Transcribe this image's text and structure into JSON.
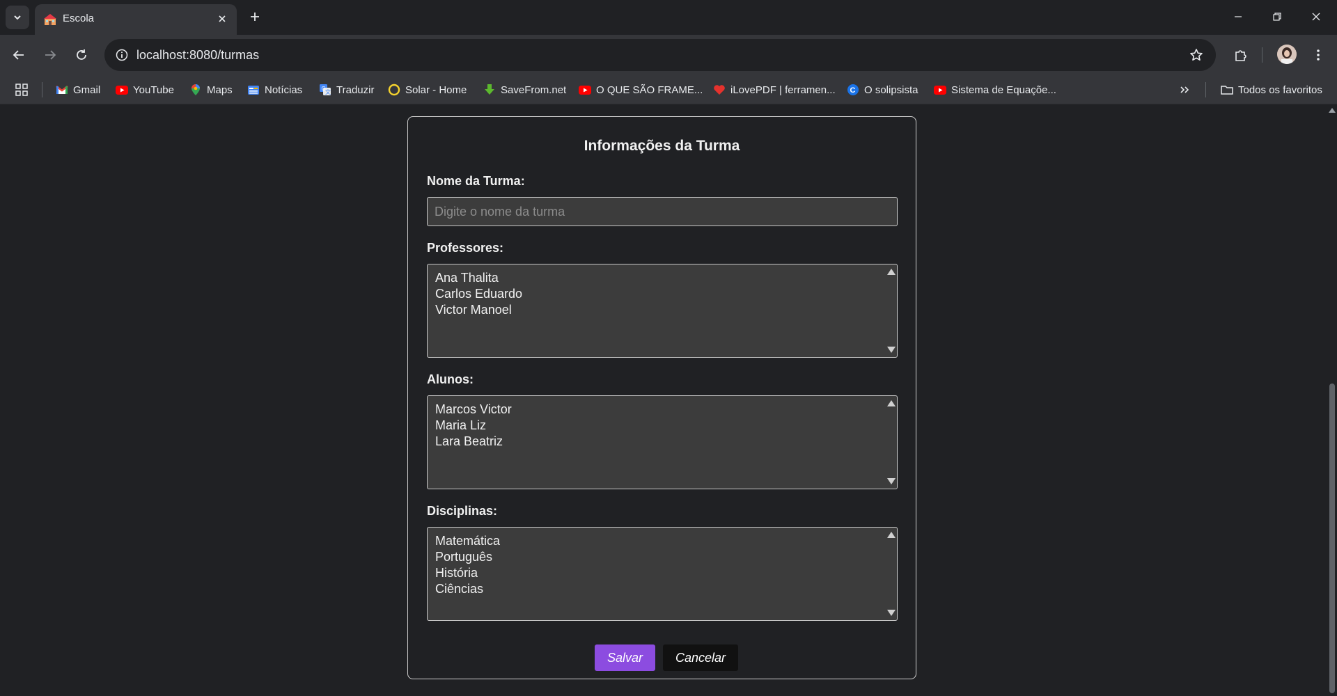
{
  "browser": {
    "tab": {
      "title": "Escola"
    },
    "address": {
      "url": "localhost:8080/turmas"
    },
    "bookmarks": [
      {
        "label": "Gmail",
        "icon": "gmail-icon"
      },
      {
        "label": "YouTube",
        "icon": "youtube-icon"
      },
      {
        "label": "Maps",
        "icon": "maps-icon"
      },
      {
        "label": "Notícias",
        "icon": "news-icon"
      },
      {
        "label": "Traduzir",
        "icon": "translate-icon"
      },
      {
        "label": "Solar - Home",
        "icon": "solar-icon"
      },
      {
        "label": "SaveFrom.net",
        "icon": "savefrom-icon"
      },
      {
        "label": "O QUE SÃO FRAME...",
        "icon": "youtube-icon"
      },
      {
        "label": "iLovePDF | ferramen...",
        "icon": "ilovepdf-icon"
      },
      {
        "label": "O solipsista",
        "icon": "solipsista-icon"
      },
      {
        "label": "Sistema de Equaçõe...",
        "icon": "youtube-icon"
      }
    ],
    "all_bookmarks": "Todos os favoritos"
  },
  "form": {
    "title": "Informações da Turma",
    "nome_label": "Nome da Turma:",
    "nome_placeholder": "Digite o nome da turma",
    "professores_label": "Professores:",
    "professores": [
      "Ana Thalita",
      "Carlos Eduardo",
      "Victor Manoel"
    ],
    "alunos_label": "Alunos:",
    "alunos": [
      "Marcos Victor",
      "Maria Liz",
      "Lara Beatriz"
    ],
    "disciplinas_label": "Disciplinas:",
    "disciplinas": [
      "Matemática",
      "Português",
      "História",
      "Ciências"
    ],
    "save_label": "Salvar",
    "cancel_label": "Cancelar"
  },
  "colors": {
    "background": "#202124",
    "save_button": "#8c4ce0",
    "cancel_button": "#111111",
    "input_bg": "#3c3c3c"
  }
}
